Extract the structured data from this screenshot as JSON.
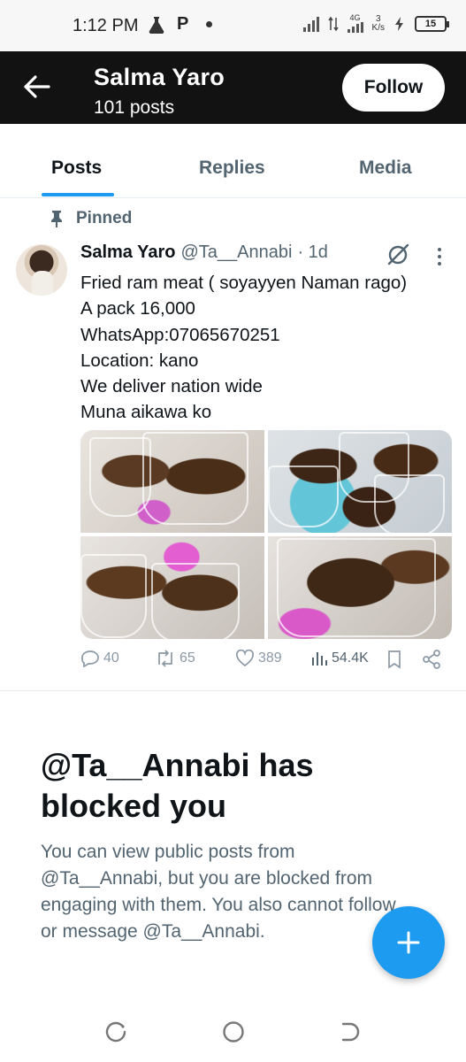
{
  "status_bar": {
    "time": "1:12 PM",
    "p_glyph": "P",
    "network_label": "4G",
    "speed_value": "3",
    "speed_unit": "K/s",
    "battery": "15"
  },
  "header": {
    "name": "Salma Yaro",
    "posts_count": "101 posts",
    "follow_label": "Follow"
  },
  "tabs": [
    {
      "label": "Posts",
      "active": true
    },
    {
      "label": "Replies",
      "active": false
    },
    {
      "label": "Media",
      "active": false
    }
  ],
  "post": {
    "pinned_label": "Pinned",
    "author_name": "Salma Yaro",
    "handle": "@Ta__Annabi",
    "time": "· 1d",
    "lines": [
      "Fried ram meat ( soyayyen Naman rago)",
      "A pack 16,000",
      "WhatsApp:07065670251",
      "Location: kano",
      "We deliver nation wide",
      "Muna aikawa ko"
    ],
    "stats": {
      "replies": "40",
      "reposts": "65",
      "likes": "389",
      "views": "54.4K"
    }
  },
  "blocked": {
    "title": "@Ta__Annabi has blocked you",
    "description": "You can view public posts from @Ta__Annabi, but you are blocked from engaging with them. You also cannot follow or message @Ta__Annabi."
  },
  "colors": {
    "accent": "#1d9bf0",
    "header_bg": "#121212",
    "muted_text": "#536471"
  }
}
